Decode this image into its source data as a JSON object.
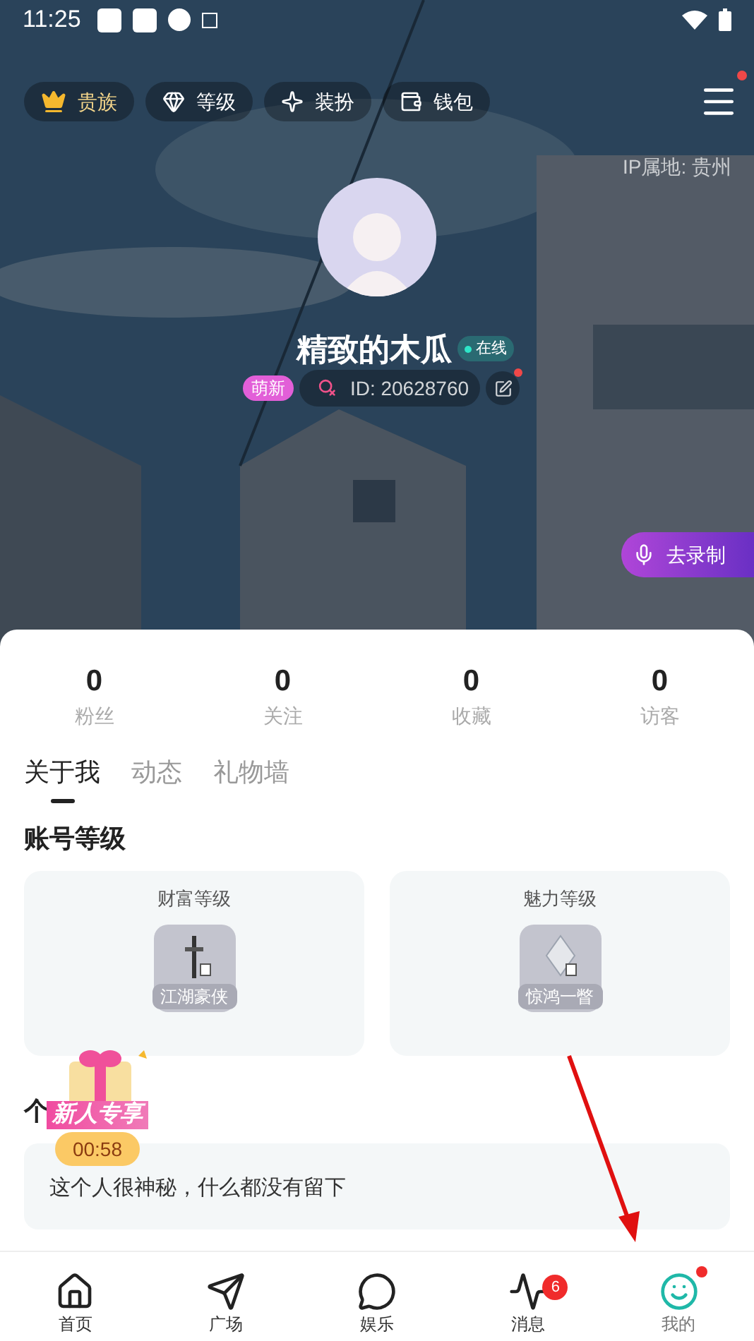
{
  "status_bar": {
    "time": "11:25"
  },
  "top_chips": [
    {
      "label": "贵族",
      "kind": "crown"
    },
    {
      "label": "等级",
      "kind": "gem"
    },
    {
      "label": "装扮",
      "kind": "outfit"
    },
    {
      "label": "钱包",
      "kind": "wallet"
    }
  ],
  "menu": {
    "badge": true
  },
  "ip_location": "IP属地: 贵州",
  "profile": {
    "name": "精致的木瓜",
    "online_label": "在线",
    "tag": "萌新",
    "id": "ID: 20628760",
    "edit_badge": true
  },
  "record_button": "去录制",
  "stats": [
    {
      "value": "0",
      "label": "粉丝"
    },
    {
      "value": "0",
      "label": "关注"
    },
    {
      "value": "0",
      "label": "收藏"
    },
    {
      "value": "0",
      "label": "访客"
    }
  ],
  "tabs": [
    {
      "label": "关于我",
      "selected": true
    },
    {
      "label": "动态",
      "selected": false
    },
    {
      "label": "礼物墙",
      "selected": false
    }
  ],
  "account_level": {
    "title": "账号等级",
    "cards": [
      {
        "title": "财富等级",
        "badge_label": "江湖豪侠",
        "kind": "wealth"
      },
      {
        "title": "魅力等级",
        "badge_label": "惊鸿一瞥",
        "kind": "charm"
      }
    ]
  },
  "intro": {
    "heading": "个",
    "text": "这个人很神秘，什么都没有留下"
  },
  "promo": {
    "title": "新人专享",
    "countdown": "00:58"
  },
  "bottom_nav": [
    {
      "label": "首页",
      "kind": "home",
      "selected": false
    },
    {
      "label": "广场",
      "kind": "plaza",
      "selected": false
    },
    {
      "label": "娱乐",
      "kind": "fun",
      "selected": false
    },
    {
      "label": "消息",
      "kind": "message",
      "selected": false,
      "badge": "6"
    },
    {
      "label": "我的",
      "kind": "me",
      "selected": true,
      "dot": true
    }
  ]
}
